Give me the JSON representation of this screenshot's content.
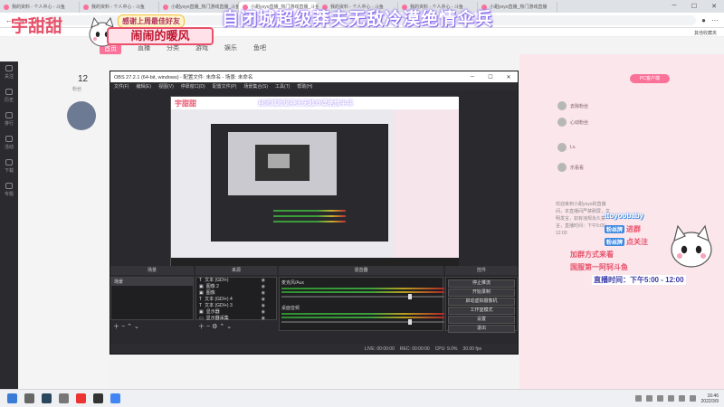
{
  "browser": {
    "tabs": [
      {
        "label": "我的资料 - 个人中心 - 斗鱼",
        "active": false
      },
      {
        "label": "我的资料 - 个人中心 - 斗鱼",
        "active": false
      },
      {
        "label": "小甜yoyo直播_热门游戏直播_斗鱼",
        "active": false
      },
      {
        "label": "小甜yoyo直播_热门游戏直播_斗鱼",
        "active": true
      },
      {
        "label": "我的资料 - 个人中心 - 斗鱼",
        "active": false
      },
      {
        "label": "我的资料 - 个人中心 - 斗鱼",
        "active": false
      },
      {
        "label": "小甜yoyo直播_热门游戏直播",
        "active": false
      }
    ],
    "other_bookmarks": "其他收藏夹"
  },
  "overlay": {
    "streamer_name": "宇甜甜",
    "gift_tag": "感谢上周最佳好友",
    "nick_tag": "闹闹的暖风",
    "banner": "自闭城超级莽夫无敌冷漠绝情伞兵"
  },
  "site_nav": [
    "首页",
    "直播",
    "分类",
    "游戏",
    "娱乐",
    "鱼吧"
  ],
  "left_rail": [
    "关注",
    "历史",
    "排行",
    "活动",
    "下载",
    "专题"
  ],
  "stats": {
    "count": "12",
    "label": "粉丝"
  },
  "right_panel": {
    "follow_button": "PC客户端",
    "rows": [
      "去除粉丝",
      "心动粉丝",
      "Lv.",
      "乐看看"
    ],
    "paragraph": "欢迎来到小甜yoyo的直播间，本直播间严禁刷屏，文明发言，如有违规永久禁言，直播时间：下午5:00 - 12:00"
  },
  "obs": {
    "title": "OBS 27.2.1 (64-bit, windows) - 配置文件: 未命名 - 场景: 未命名",
    "menu": [
      "文件(F)",
      "编辑(E)",
      "视图(V)",
      "停靠窗口(D)",
      "配置文件(P)",
      "场景集合(S)",
      "工具(T)",
      "帮助(H)"
    ],
    "scene_header": "场景",
    "source_header": "来源",
    "mixer_header": "混音器",
    "transition_header": "转场特效",
    "controls_header": "控件",
    "scenes": [
      "场景"
    ],
    "sources": [
      {
        "icon": "T",
        "label": "文本 (GDI+)"
      },
      {
        "icon": "▣",
        "label": "图像 2"
      },
      {
        "icon": "▣",
        "label": "图像"
      },
      {
        "icon": "T",
        "label": "文本 (GDI+) 4"
      },
      {
        "icon": "T",
        "label": "文本 (GDI+) 3"
      },
      {
        "icon": "▣",
        "label": "显示器"
      },
      {
        "icon": "▭",
        "label": "显示器采集"
      }
    ],
    "mixer": [
      {
        "label": "麦克风/Aux",
        "db": "0.0 dB"
      },
      {
        "label": "桌面音频",
        "db": "0.0 dB"
      }
    ],
    "controls": [
      "停止推流",
      "开始录制",
      "启动虚拟摄像机",
      "工作室模式",
      "设置",
      "退出"
    ],
    "status": [
      "LIVE: 00:00:00",
      "REC: 00:00:00",
      "CPU: 9.0%",
      "30.00 fps"
    ]
  },
  "stream_overlay": {
    "name": "ttoyoobaby",
    "lines": [
      {
        "badge": "粉丝牌",
        "text": "进群",
        "color": "#e8516a"
      },
      {
        "badge": "粉丝牌",
        "text": "点关注",
        "color": "#e8516a"
      },
      {
        "badge": "",
        "text": "加群方式来看",
        "color": "#e8516a"
      },
      {
        "badge": "",
        "text": "国服第一阿轲斗鱼",
        "color": "#e8516a"
      }
    ],
    "live_time": "直播时间：下午5:00 - 12:00"
  },
  "taskbar": {
    "time": "16:46",
    "date": "2022/3/9"
  }
}
